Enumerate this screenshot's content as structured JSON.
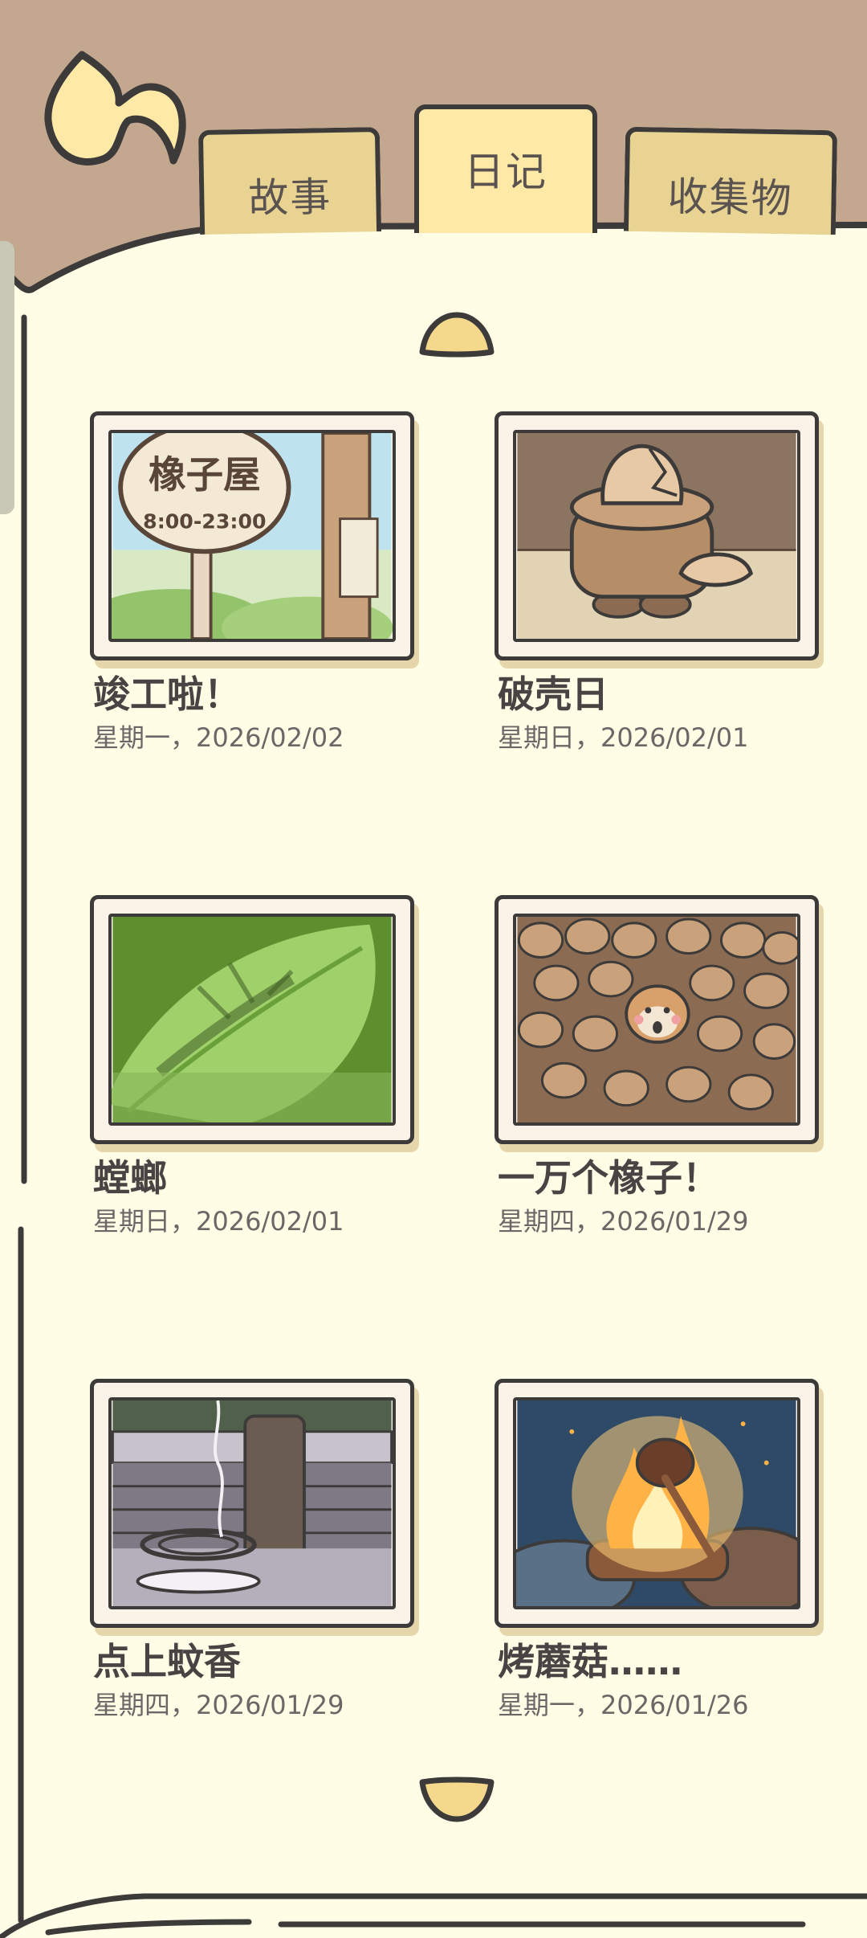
{
  "tabs": [
    {
      "label": "故事",
      "selected": false
    },
    {
      "label": "日记",
      "selected": true
    },
    {
      "label": "收集物",
      "selected": false
    }
  ],
  "colors": {
    "background": "#c4a78f",
    "paper": "#fffde6",
    "tab": "#e8d392",
    "tab_selected": "#ffe9a6",
    "outline": "#3d3a3a",
    "arrow": "#f4d98c"
  },
  "icons": {
    "back": "back-arrow-icon",
    "scroll_up": "scroll-up-icon",
    "scroll_down": "scroll-down-icon"
  },
  "entries": [
    {
      "title": "竣工啦！",
      "date": "星期一，2026/02/02",
      "image": "acorn-house-sign",
      "sign_text": "橡子屋",
      "sign_hours": "8:00-23:00"
    },
    {
      "title": "破壳日",
      "date": "星期日，2026/02/01",
      "image": "cracked-egg-on-stump"
    },
    {
      "title": "螳螂",
      "date": "星期日，2026/02/01",
      "image": "mantis-on-leaf"
    },
    {
      "title": "一万个橡子！",
      "date": "星期四，2026/01/29",
      "image": "squirrel-in-acorns"
    },
    {
      "title": "点上蚊香",
      "date": "星期四，2026/01/29",
      "image": "mosquito-coil"
    },
    {
      "title": "烤蘑菇……",
      "date": "星期一，2026/01/26",
      "image": "roasting-mushroom"
    }
  ]
}
